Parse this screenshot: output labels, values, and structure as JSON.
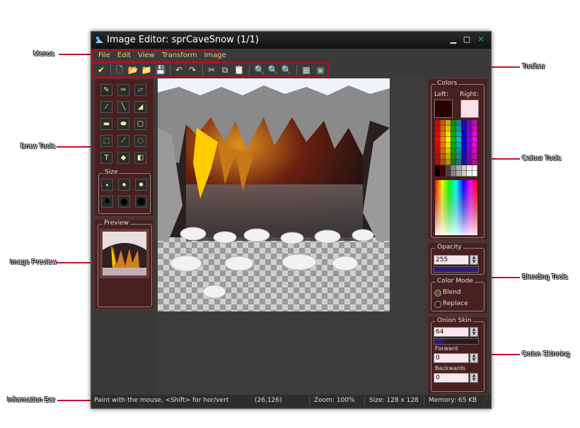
{
  "window": {
    "title": "Image Editor: sprCaveSnow (1/1)"
  },
  "menu": [
    "File",
    "Edit",
    "View",
    "Transform",
    "Image"
  ],
  "callouts": {
    "menus": "Menus",
    "toolbar": "Toolbar",
    "draw_tools": "Draw Tools",
    "colour_tools": "Colour Tools",
    "image_preview": "Image Preview",
    "blending_tools": "Blending Tools",
    "onion_skinning": "Onion Skinning",
    "information_bar": "Information Bar"
  },
  "draw_tools": {
    "size_label": "Size"
  },
  "preview": {
    "label": "Preview"
  },
  "colors": {
    "label": "Colors",
    "left_label": "Left:",
    "right_label": "Right:",
    "left_color": "#2a0000",
    "right_color": "#ffe0e8"
  },
  "opacity": {
    "label": "Opacity",
    "value": "255"
  },
  "color_mode": {
    "label": "Color Mode",
    "blend": "Blend",
    "replace": "Replace"
  },
  "onion": {
    "label": "Onion Skin",
    "value": "64",
    "forward_label": "Forward",
    "forward_value": "0",
    "backwards_label": "Backwards",
    "backwards_value": "0"
  },
  "status": {
    "hint": "Paint with the mouse, <Shift> for hor/vert",
    "coords": "(26,126)",
    "zoom": "Zoom: 100%",
    "size": "Size: 128 x 128",
    "memory": "Memory: 65 KB"
  }
}
